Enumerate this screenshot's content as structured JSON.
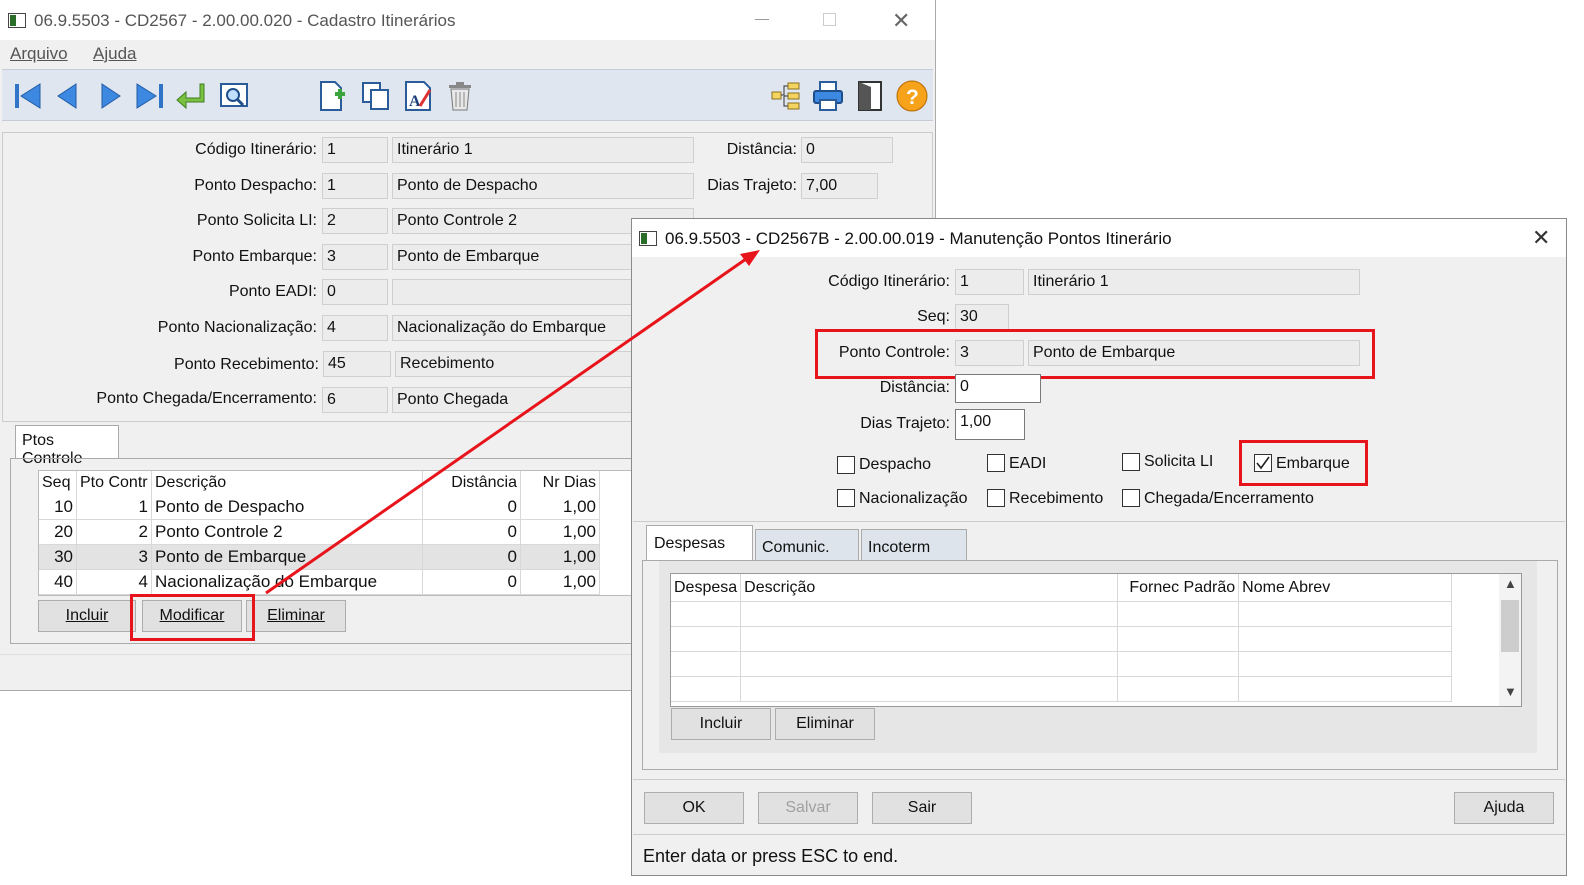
{
  "main_window": {
    "title": "06.9.5503 - CD2567 - 2.00.00.020 - Cadastro Itinerários",
    "menu": {
      "arquivo": "Arquivo",
      "ajuda": "Ajuda"
    },
    "fields": {
      "codigo_itinerario": {
        "label": "Código Itinerário:",
        "code": "1",
        "desc": "Itinerário 1"
      },
      "ponto_despacho": {
        "label": "Ponto Despacho:",
        "code": "1",
        "desc": "Ponto de Despacho"
      },
      "ponto_solicita_li": {
        "label": "Ponto Solicita LI:",
        "code": "2",
        "desc": "Ponto Controle 2"
      },
      "ponto_embarque": {
        "label": "Ponto Embarque:",
        "code": "3",
        "desc": "Ponto de Embarque"
      },
      "ponto_eadi": {
        "label": "Ponto EADI:",
        "code": "0",
        "desc": ""
      },
      "ponto_nacionalizacao": {
        "label": "Ponto Nacionalização:",
        "code": "4",
        "desc": "Nacionalização do Embarque"
      },
      "ponto_recebimento": {
        "label": "Ponto Recebimento:",
        "code": "45",
        "desc": "Recebimento"
      },
      "ponto_chegada": {
        "label": "Ponto Chegada/Encerramento:",
        "code": "6",
        "desc": "Ponto Chegada"
      },
      "distancia": {
        "label": "Distância:",
        "value": "0"
      },
      "dias_trajeto": {
        "label": "Dias Trajeto:",
        "value": "7,00"
      }
    },
    "tab": "Ptos Controle",
    "grid": {
      "headers": [
        "Seq",
        "Pto Contr",
        "Descrição",
        "Distância",
        "Nr Dias"
      ],
      "rows": [
        {
          "seq": "10",
          "pto": "1",
          "desc": "Ponto de Despacho",
          "dist": "0",
          "dias": "1,00"
        },
        {
          "seq": "20",
          "pto": "2",
          "desc": "Ponto Controle 2",
          "dist": "0",
          "dias": "1,00"
        },
        {
          "seq": "30",
          "pto": "3",
          "desc": "Ponto de Embarque",
          "dist": "0",
          "dias": "1,00"
        },
        {
          "seq": "40",
          "pto": "4",
          "desc": "Nacionalização do Embarque",
          "dist": "0",
          "dias": "1,00"
        }
      ]
    },
    "buttons": {
      "incluir": "Incluir",
      "modificar": "Modificar",
      "eliminar": "Eliminar"
    }
  },
  "dialog": {
    "title": "06.9.5503 - CD2567B - 2.00.00.019 - Manutenção Pontos Itinerário",
    "fields": {
      "codigo_itinerario": {
        "label": "Código Itinerário:",
        "code": "1",
        "desc": "Itinerário 1"
      },
      "seq": {
        "label": "Seq:",
        "value": "30"
      },
      "ponto_controle": {
        "label": "Ponto Controle:",
        "code": "3",
        "desc": "Ponto de Embarque"
      },
      "distancia": {
        "label": "Distância:",
        "value": "0"
      },
      "dias_trajeto": {
        "label": "Dias Trajeto:",
        "value": "1,00"
      }
    },
    "checkboxes": {
      "despacho": {
        "label": "Despacho",
        "checked": false
      },
      "eadi": {
        "label": "EADI",
        "checked": false
      },
      "solicita_li": {
        "label": "Solicita LI",
        "checked": false
      },
      "embarque": {
        "label": "Embarque",
        "checked": true
      },
      "nacionalizacao": {
        "label": "Nacionalização",
        "checked": false
      },
      "recebimento": {
        "label": "Recebimento",
        "checked": false
      },
      "chegada": {
        "label": "Chegada/Encerramento",
        "checked": false
      }
    },
    "tabs": [
      "Despesas",
      "Comunic.",
      "Incoterm"
    ],
    "grid_headers": [
      "Despesa",
      "Descrição",
      "Fornec Padrão",
      "Nome Abrev"
    ],
    "grid_buttons": {
      "incluir": "Incluir",
      "eliminar": "Eliminar"
    },
    "footer_buttons": {
      "ok": "OK",
      "salvar": "Salvar",
      "sair": "Sair",
      "ajuda": "Ajuda"
    },
    "status": "Enter data or press ESC to end."
  },
  "colors": {
    "highlight": "#e8141b",
    "window_bg": "#f0f0f0",
    "toolbar_bg": "#dfe6f0"
  }
}
